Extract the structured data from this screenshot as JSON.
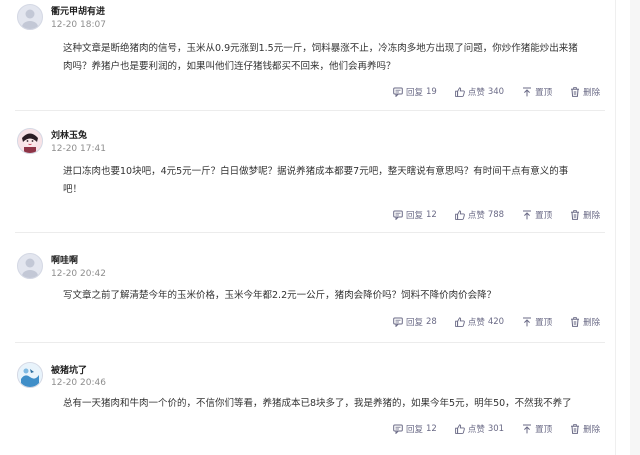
{
  "comments": [
    {
      "username": "衢元甲胡有进",
      "time": "12-20 18:07",
      "content_line1": "这种文章是断绝猪肉的信号，玉米从0.9元涨到1.5元一斤，饲料暴涨不止，冷冻肉多地方出现了问题，你炒作猪能炒出来猪",
      "content_line2": "肉吗？养猪户也是要利润的，如果叫他们连仔猪钱都买不回来，他们会再养吗？",
      "reply_label": "回复",
      "reply_count": "19",
      "like_label": "点赞",
      "like_count": "340",
      "pin_label": "置顶",
      "delete_label": "删除"
    },
    {
      "username": "刘林玉兔",
      "time": "12-20 17:41",
      "content_line1": "进口冻肉也要10块吧，4元5元一斤？白日做梦呢？据说养猪成本都要7元吧，整天瞎说有意思吗？有时间干点有意义的事",
      "content_line2": "吧！",
      "reply_label": "回复",
      "reply_count": "12",
      "like_label": "点赞",
      "like_count": "788",
      "pin_label": "置顶",
      "delete_label": "删除"
    },
    {
      "username": "啊哇啊",
      "time": "12-20 20:42",
      "content_line1": "写文章之前了解清楚今年的玉米价格，玉米今年都2.2元一公斤，猪肉会降价吗？饲料不降价肉价会降？",
      "content_line2": "",
      "reply_label": "回复",
      "reply_count": "28",
      "like_label": "点赞",
      "like_count": "420",
      "pin_label": "置顶",
      "delete_label": "删除"
    },
    {
      "username": "被猪坑了",
      "time": "12-20 20:46",
      "content_line1": "总有一天猪肉和牛肉一个价的，不信你们等看，养猪成本已8块多了，我是养猪的，如果今年5元，明年50，不然我不养了",
      "content_line2": "",
      "reply_label": "回复",
      "reply_count": "12",
      "like_label": "点赞",
      "like_count": "301",
      "pin_label": "置顶",
      "delete_label": "删除"
    }
  ],
  "colors": {
    "action_text": "#6a6a86",
    "meta_text": "#8e8e8e",
    "body_text": "#333333"
  },
  "icons": [
    "default-avatar-icon",
    "user-avatar-icon",
    "comment-icon",
    "thumbs-up-icon",
    "pin-icon",
    "trash-icon"
  ]
}
